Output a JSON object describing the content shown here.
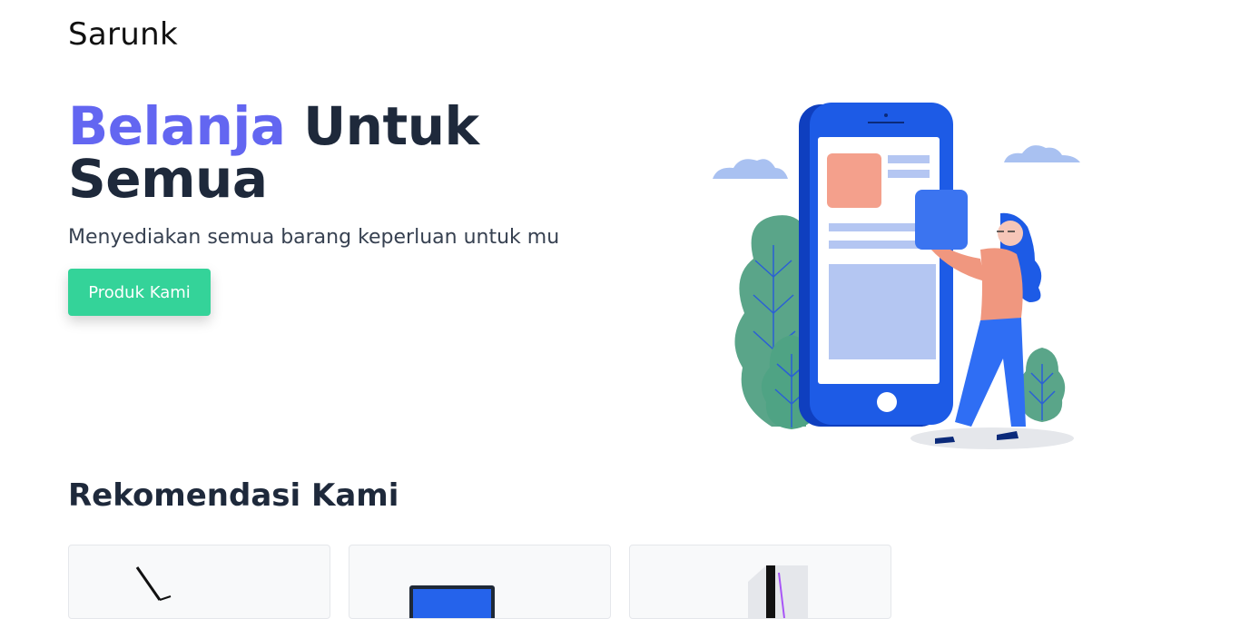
{
  "header": {
    "brand": "Sarunk"
  },
  "hero": {
    "title_accent": "Belanja",
    "title_rest_line1": "Untuk",
    "title_line2": "Semua",
    "subtitle": "Menyediakan semua barang keperluan untuk mu",
    "cta_label": "Produk Kami"
  },
  "recommendations": {
    "title": "Rekomendasi Kami",
    "items": [
      {
        "icon": "stylus-product-image"
      },
      {
        "icon": "laptop-product-image"
      },
      {
        "icon": "pc-case-product-image"
      }
    ]
  },
  "colors": {
    "accent": "#6366f1",
    "button": "#34d399",
    "heading": "#1e293b",
    "illustration_blue": "#1d5be6"
  }
}
